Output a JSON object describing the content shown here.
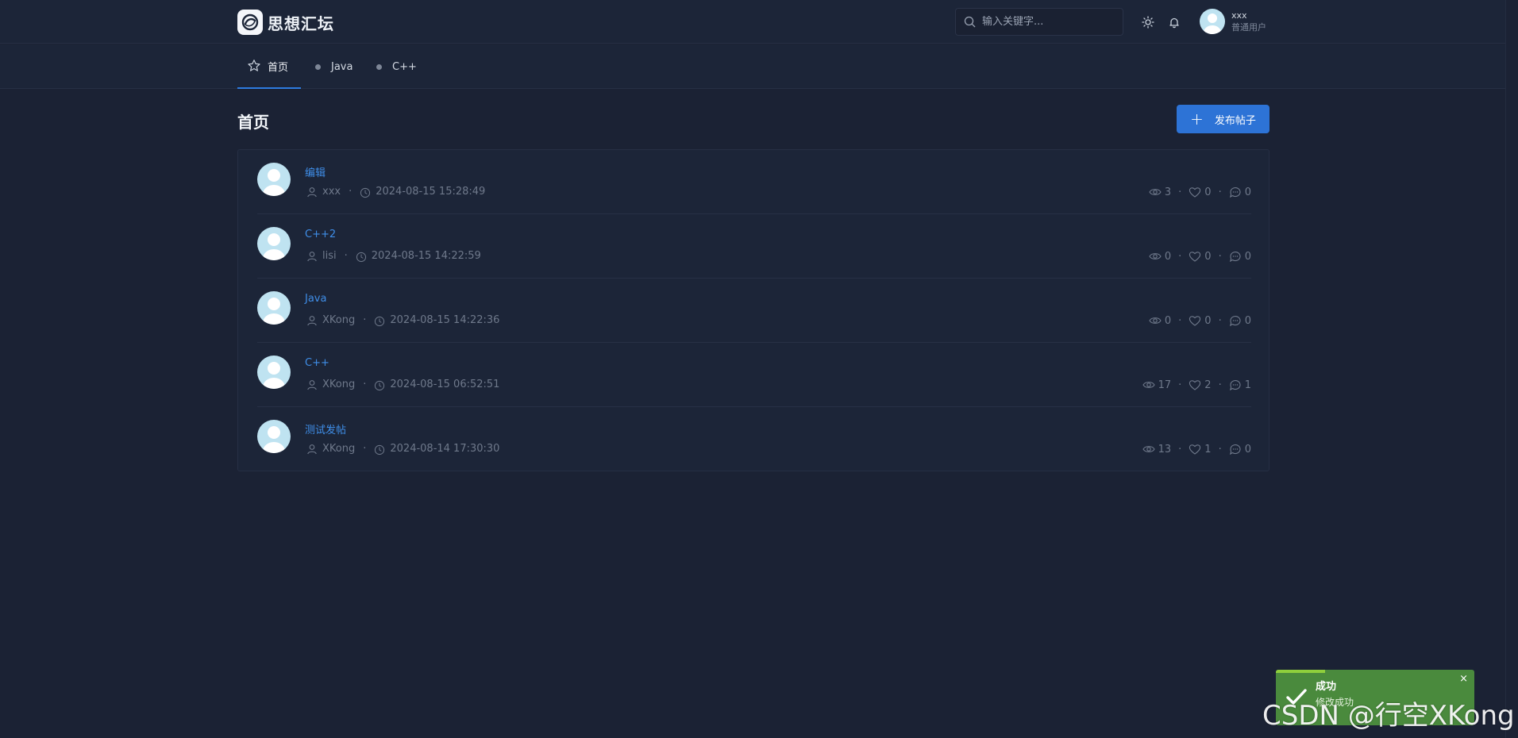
{
  "header": {
    "logo_text": "思想汇坛",
    "search_placeholder": "输入关键字...",
    "user_name": "xxx",
    "user_role": "普通用户"
  },
  "tabs": [
    {
      "label": "首页",
      "active": true
    },
    {
      "label": "Java",
      "active": false
    },
    {
      "label": "C++",
      "active": false
    }
  ],
  "main": {
    "title": "首页",
    "publish_label": "发布帖子"
  },
  "posts": [
    {
      "title": "编辑",
      "author": "xxx",
      "time": "2024-08-15 15:28:49",
      "views": "3",
      "likes": "0",
      "comments": "0"
    },
    {
      "title": "C++2",
      "author": "lisi",
      "time": "2024-08-15 14:22:59",
      "views": "0",
      "likes": "0",
      "comments": "0"
    },
    {
      "title": "Java",
      "author": "XKong",
      "time": "2024-08-15 14:22:36",
      "views": "0",
      "likes": "0",
      "comments": "0"
    },
    {
      "title": "C++",
      "author": "XKong",
      "time": "2024-08-15 06:52:51",
      "views": "17",
      "likes": "2",
      "comments": "1"
    },
    {
      "title": "测试发帖",
      "author": "XKong",
      "time": "2024-08-14 17:30:30",
      "views": "13",
      "likes": "1",
      "comments": "0"
    }
  ],
  "separator": "·",
  "toast": {
    "title": "成功",
    "message": "修改成功",
    "close": "×"
  },
  "watermark": "CSDN @行空XKong",
  "colors": {
    "background": "#1b2234",
    "accent": "#2d73d6",
    "link": "#3f8ee8",
    "toast": "#4a8a3d"
  }
}
